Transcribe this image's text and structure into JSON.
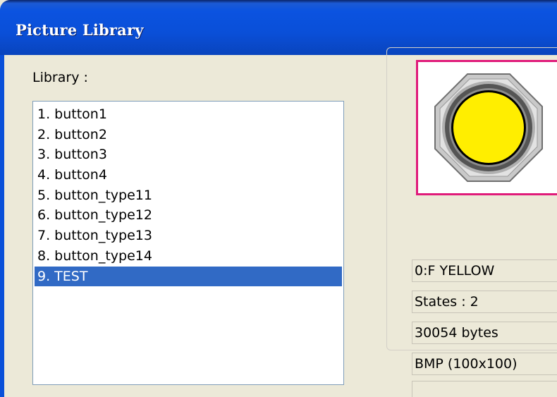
{
  "window": {
    "title": "Picture Library"
  },
  "library": {
    "label": "Library :",
    "items": [
      "1. button1",
      "2. button2",
      "3. button3",
      "4. button4",
      "5. button_type11",
      "6. button_type12",
      "7. button_type13",
      "8. button_type14",
      "9. TEST"
    ],
    "selected_index": 8
  },
  "preview": {
    "icon": "yellow-round-button-icon",
    "colors": {
      "frame": "#e01a7a",
      "button_fill": "#ffee00",
      "selection": "#316ac5"
    }
  },
  "info": {
    "picture_name": "0:F YELLOW",
    "states": "States : 2",
    "size": "30054 bytes",
    "format": "BMP (100x100)",
    "extra": ""
  }
}
